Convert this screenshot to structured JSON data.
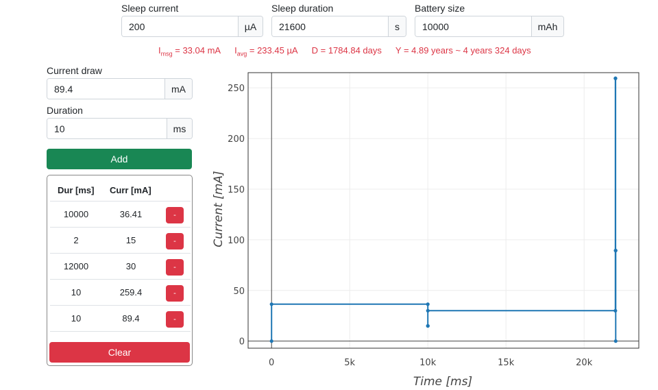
{
  "settings": {
    "sleep_current": {
      "label": "Sleep current",
      "value": "200",
      "unit": "µA"
    },
    "sleep_duration": {
      "label": "Sleep duration",
      "value": "21600",
      "unit": "s"
    },
    "battery_size": {
      "label": "Battery size",
      "value": "10000",
      "unit": "mAh"
    }
  },
  "stats": {
    "imsg_sym": "I",
    "imsg_sub": "msg",
    "imsg_val": " = 33.04 mA",
    "iavg_sym": "I",
    "iavg_sub": "avg",
    "iavg_val": " = 233.45 µA",
    "days": "D = 1784.84 days",
    "years": "Y = 4.89 years ~ 4 years 324 days"
  },
  "form": {
    "current_draw": {
      "label": "Current draw",
      "value": "89.4",
      "unit": "mA"
    },
    "duration": {
      "label": "Duration",
      "value": "10",
      "unit": "ms"
    },
    "add_label": "Add"
  },
  "table": {
    "headers": [
      "Dur [ms]",
      "Curr [mA]"
    ],
    "rows": [
      {
        "dur": "10000",
        "curr": "36.41"
      },
      {
        "dur": "2",
        "curr": "15"
      },
      {
        "dur": "12000",
        "curr": "30"
      },
      {
        "dur": "10",
        "curr": "259.4"
      },
      {
        "dur": "10",
        "curr": "89.4"
      }
    ],
    "remove_label": "-",
    "clear_label": "Clear"
  },
  "colors": {
    "line": "#1f77b4",
    "add": "#198754",
    "danger": "#dc3545",
    "stats": "#dc3545"
  },
  "chart_data": {
    "type": "line",
    "shape": "step",
    "title": "",
    "xlabel": "Time [ms]",
    "ylabel": "Current [mA]",
    "xlim": [
      -1500,
      23500
    ],
    "ylim": [
      -7,
      265
    ],
    "xticks": [
      0,
      5000,
      10000,
      15000,
      20000
    ],
    "xtick_labels": [
      "0",
      "5k",
      "10k",
      "15k",
      "20k"
    ],
    "yticks": [
      0,
      50,
      100,
      150,
      200,
      250
    ],
    "ytick_labels": [
      "0",
      "50",
      "100",
      "150",
      "200",
      "250"
    ],
    "grid": true,
    "series": [
      {
        "x": [
          0,
          0,
          10000,
          10000,
          10002,
          10002,
          22002,
          22002,
          22012,
          22012,
          22022,
          22022
        ],
        "y": [
          0,
          36.41,
          36.41,
          15,
          15,
          30,
          30,
          259.4,
          259.4,
          89.4,
          89.4,
          0
        ]
      }
    ]
  }
}
